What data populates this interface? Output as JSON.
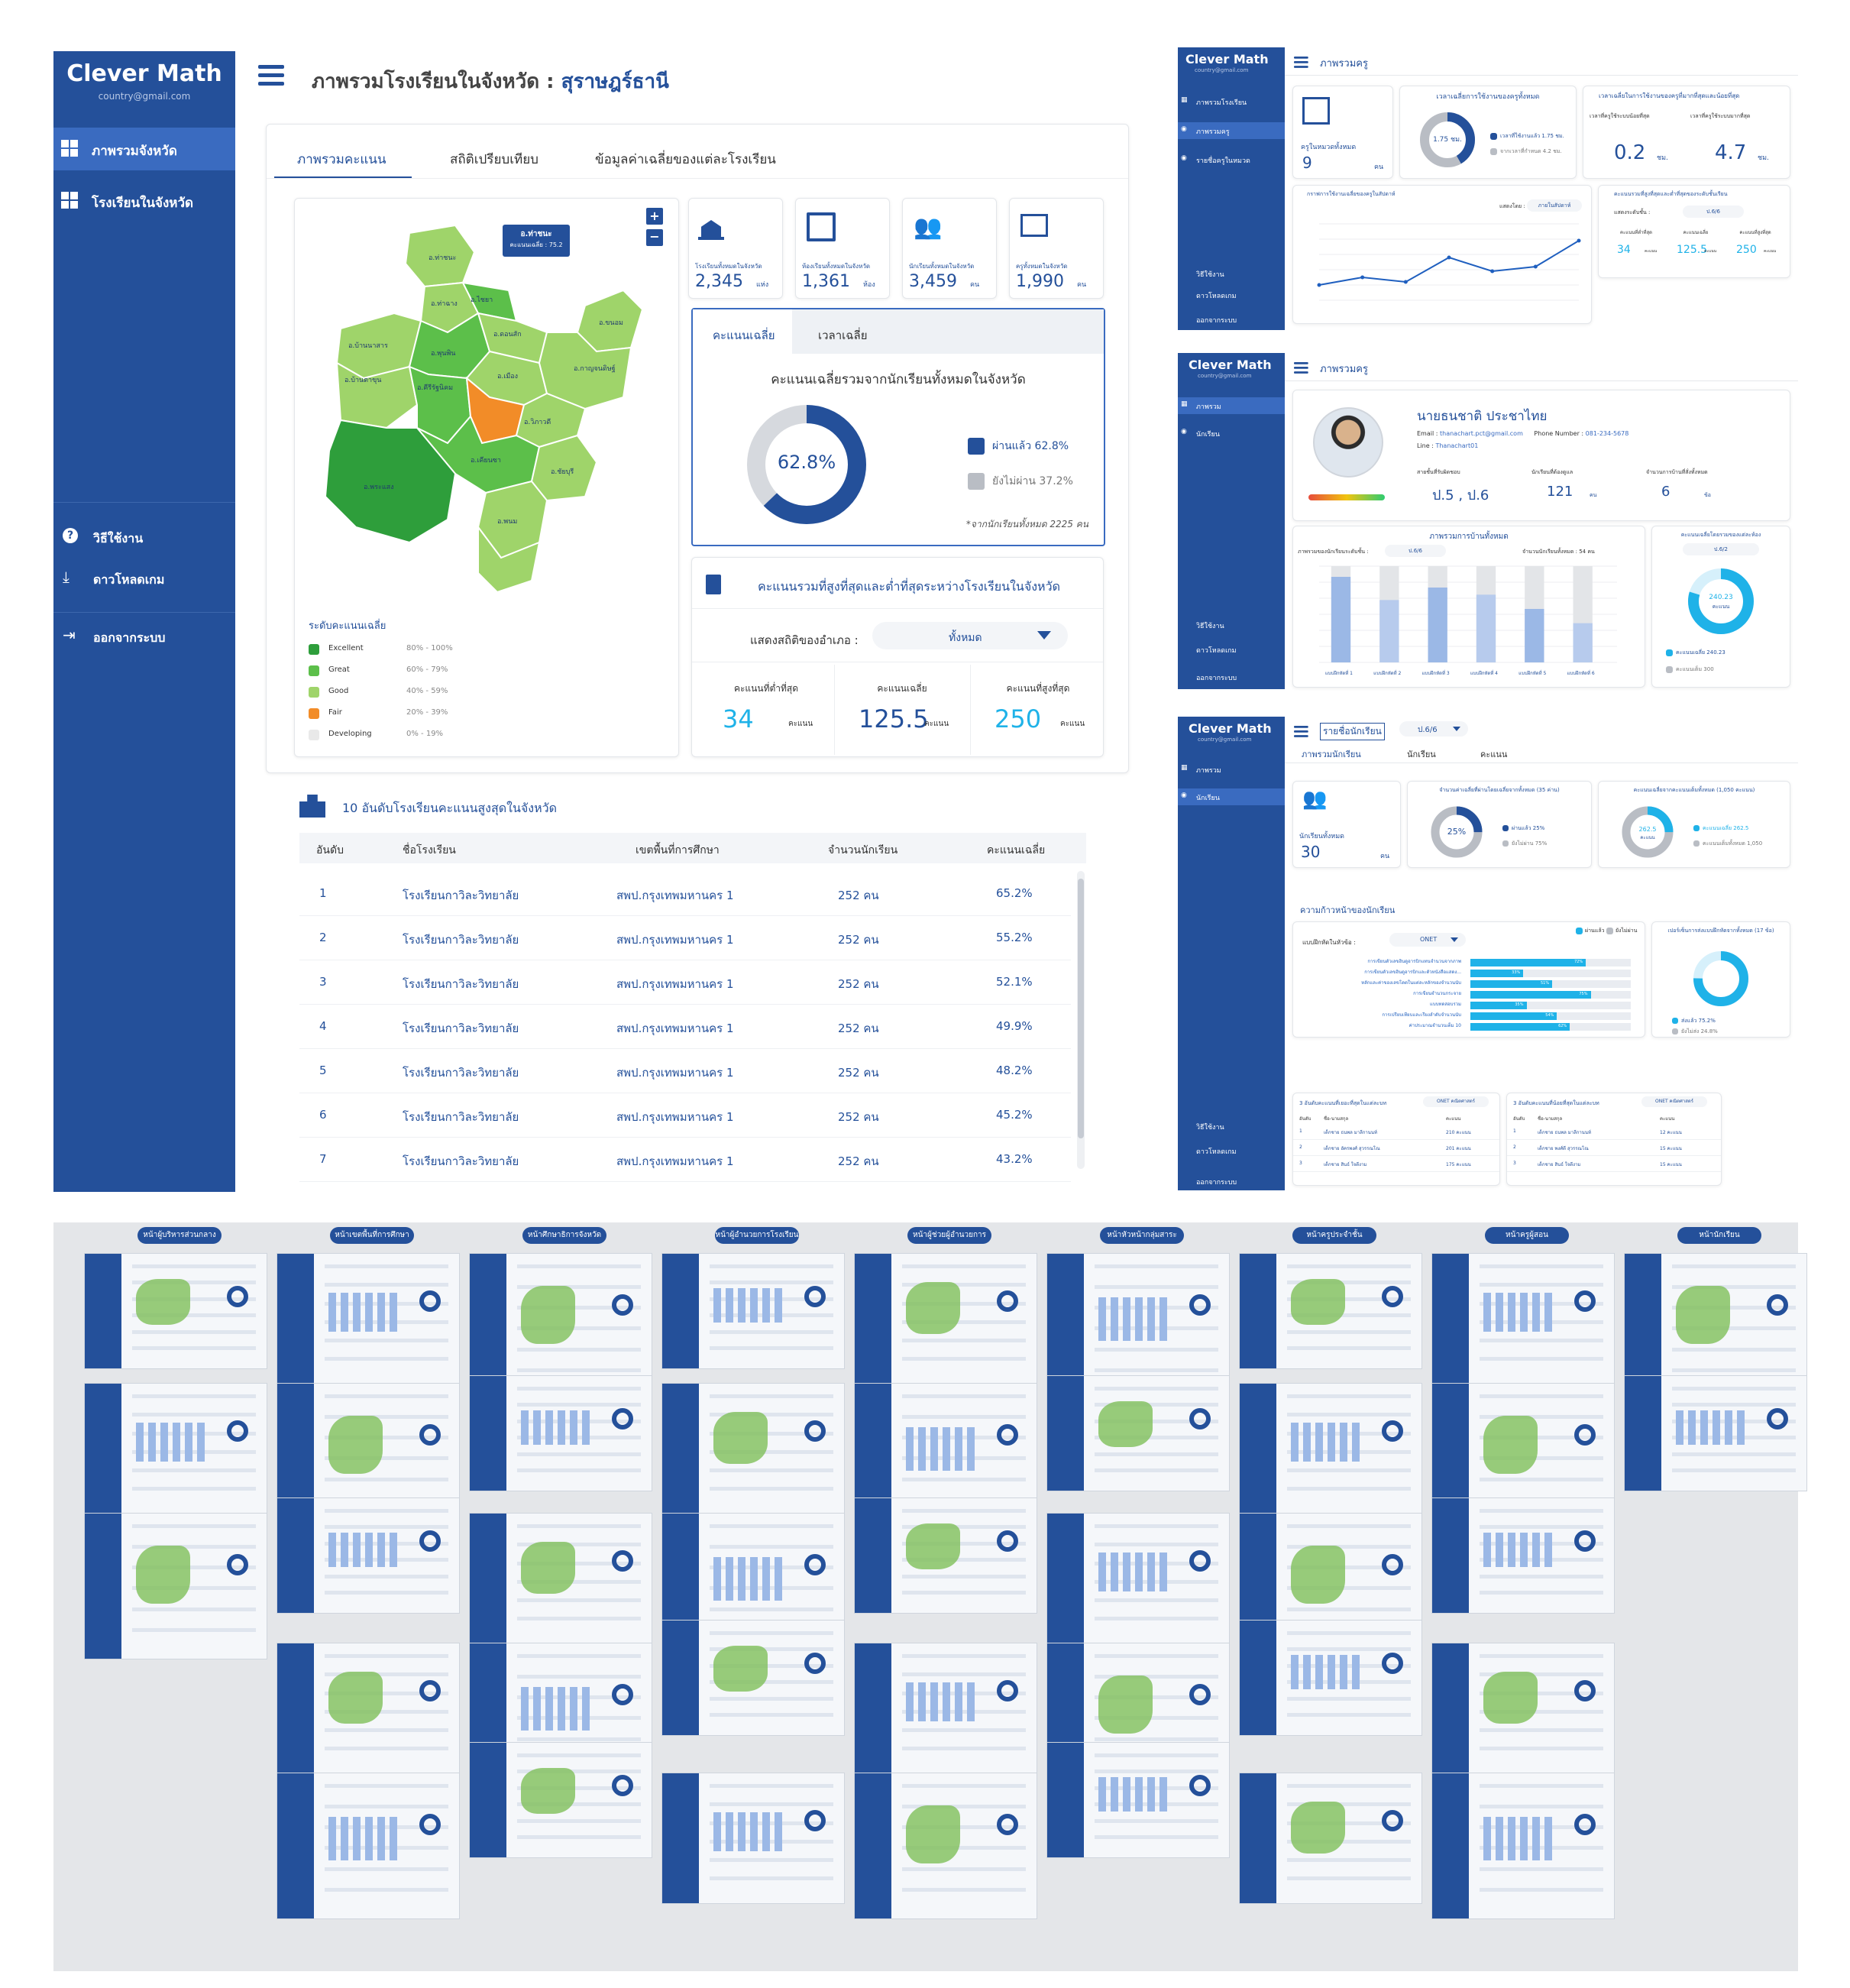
{
  "app": {
    "name": "Clever Math",
    "email": "country@gmail.com"
  },
  "main": {
    "title_prefix": "ภาพรวมโรงเรียนในจังหวัด :",
    "province": "สุราษฎร์ธานี",
    "sidebar": {
      "items": [
        {
          "label": "ภาพรวมจังหวัด",
          "active": true
        },
        {
          "label": "โรงเรียนในจังหวัด",
          "active": false
        }
      ],
      "bottom": [
        {
          "label": "วิธีใช้งาน",
          "icon": "help-icon"
        },
        {
          "label": "ดาวโหลดเกม",
          "icon": "download-icon"
        },
        {
          "label": "ออกจากระบบ",
          "icon": "logout-icon"
        }
      ]
    },
    "tabs": [
      "ภาพรวมคะแนน",
      "สถิติเปรียบเทียบ",
      "ข้อมูลค่าเฉลี่ยของแต่ละโรงเรียน"
    ],
    "map": {
      "tooltip_title": "อ.ท่าชนะ",
      "tooltip_value": "คะแนนเฉลี่ย : 75.2",
      "legend_title": "ระดับคะแนนเฉลี่ย",
      "legend": [
        {
          "label": "Excellent",
          "range": "80% - 100%",
          "color": "#2e9e3b"
        },
        {
          "label": "Great",
          "range": "60% - 79%",
          "color": "#5cbf4a"
        },
        {
          "label": "Good",
          "range": "40% - 59%",
          "color": "#9fd46a"
        },
        {
          "label": "Fair",
          "range": "20% - 39%",
          "color": "#f28c28"
        },
        {
          "label": "Developing",
          "range": "0% - 19%",
          "color": "#e9e9e9"
        }
      ],
      "districts": [
        "อ.ท่าชนะ",
        "อ.ท่าฉาง",
        "อ.ไชยา",
        "อ.พุนพิน",
        "อ.ดอนสัก",
        "อ.ขนอม",
        "อ.กาญจนดิษฐ์",
        "อ.เมือง",
        "อ.เคียนซา",
        "อ.บ้านนาสาร",
        "อ.พระแสง",
        "อ.ชัยบุรี",
        "อ.คีรีรัฐนิคม",
        "อ.วิภาวดี",
        "อ.พนม",
        "อ.บ้านตาขุน"
      ]
    },
    "stats": [
      {
        "label": "โรงเรียนทั้งหมดในจังหวัด",
        "value": "2,345",
        "unit": "แห่ง",
        "icon": "school-icon"
      },
      {
        "label": "ห้องเรียนทั้งหมดในจังหวัด",
        "value": "1,361",
        "unit": "ห้อง",
        "icon": "classroom-icon"
      },
      {
        "label": "นักเรียนทั้งหมดในจังหวัด",
        "value": "3,459",
        "unit": "คน",
        "icon": "students-icon"
      },
      {
        "label": "ครูทั้งหมดในจังหวัด",
        "value": "1,990",
        "unit": "คน",
        "icon": "teacher-icon"
      }
    ],
    "score_card": {
      "tabs": [
        "คะแนนเฉลี่ย",
        "เวลาเฉลี่ย"
      ],
      "title": "คะแนนเฉลี่ยรวมจากนักเรียนทั้งหมดในจังหวัด",
      "center": "62.8%",
      "passed_label": "ผ่านแล้ว 62.8%",
      "failed_label": "ยังไม่ผ่าน 37.2%",
      "note": "*จากนักเรียนทั้งหมด 2225 คน",
      "passed": 62.8,
      "color_pass": "#24509a",
      "color_fail": "#d6d9de"
    },
    "minmax": {
      "title": "คะแนนรวมที่สูงที่สุดและต่ำที่สุดระหว่างโรงเรียนในจังหวัด",
      "filter_label": "แสดงสถิติของอำเภอ :",
      "filter_value": "ทั้งหมด",
      "cols": [
        {
          "label": "คะแนนที่ต่ำที่สุด",
          "value": "34",
          "unit": "คะแนน"
        },
        {
          "label": "คะแนนเฉลี่ย",
          "value": "125.5",
          "unit": "คะแนน"
        },
        {
          "label": "คะแนนที่สูงที่สุด",
          "value": "250",
          "unit": "คะแนน"
        }
      ]
    },
    "top10": {
      "title": "10 อันดับโรงเรียนคะแนนสูงสุดในจังหวัด",
      "headers": [
        "อันดับ",
        "ชื่อโรงเรียน",
        "เขตพื้นที่การศึกษา",
        "จำนวนนักเรียน",
        "คะแนนเฉลี่ย"
      ],
      "rows": [
        [
          "1",
          "โรงเรียนกาวิละวิทยาลัย",
          "สพป.กรุงเทพมหานคร 1",
          "252 คน",
          "65.2%"
        ],
        [
          "2",
          "โรงเรียนกาวิละวิทยาลัย",
          "สพป.กรุงเทพมหานคร 1",
          "252 คน",
          "55.2%"
        ],
        [
          "3",
          "โรงเรียนกาวิละวิทยาลัย",
          "สพป.กรุงเทพมหานคร 1",
          "252 คน",
          "52.1%"
        ],
        [
          "4",
          "โรงเรียนกาวิละวิทยาลัย",
          "สพป.กรุงเทพมหานคร 1",
          "252 คน",
          "49.9%"
        ],
        [
          "5",
          "โรงเรียนกาวิละวิทยาลัย",
          "สพป.กรุงเทพมหานคร 1",
          "252 คน",
          "48.2%"
        ],
        [
          "6",
          "โรงเรียนกาวิละวิทยาลัย",
          "สพป.กรุงเทพมหานคร 1",
          "252 คน",
          "45.2%"
        ],
        [
          "7",
          "โรงเรียนกาวิละวิทยาลัย",
          "สพป.กรุงเทพมหานคร 1",
          "252 คน",
          "43.2%"
        ]
      ]
    }
  },
  "panel1": {
    "app_name": "Clever Math",
    "email": "country@gmail.com",
    "title": "ภาพรวมครู",
    "nav": [
      "ภาพรวมโรงเรียน",
      "ภาพรวมครู",
      "รายชื่อครูในหมวด"
    ],
    "bottom": [
      "วิธีใช้งาน",
      "ดาวโหลดเกม",
      "ออกจากระบบ"
    ],
    "teachers_label": "ครูในหมวดทั้งหมด",
    "teachers_value": "9",
    "teachers_unit": "คน",
    "donut_title": "เวลาเฉลี่ยการใช้งานของครูทั้งหมด",
    "donut_center": "1.75 ชม.",
    "donut_legend": [
      "เวลาที่ใช้งานแล้ว 1.75 ชม.",
      "จากเวลาที่กำหนด 4.2 ชม."
    ],
    "time_title": "เวลาเฉลี่ยในการใช้งานของครูที่มากที่สุดและน้อยที่สุด",
    "min_label": "เวลาที่ครูใช้ระบบน้อยที่สุด",
    "min_value": "0.2",
    "min_unit": "ชม.",
    "max_label": "เวลาที่ครูใช้ระบบมากที่สุด",
    "max_value": "4.7",
    "max_unit": "ชม.",
    "line_title": "กราฟการใช้งานเฉลี่ยของครูในสัปดาห์",
    "line_filter_label": "แสดงโดย :",
    "line_filter_value": "ภายในสัปดาห์",
    "line_values": [
      1,
      1.5,
      1.2,
      2.8,
      1.9,
      2.2,
      3.9
    ],
    "grade_title": "คะแนนรวมที่สูงที่สุดและต่ำที่สุดของระดับชั้นเรียน",
    "grade_filter_label": "แสดงระดับชั้น :",
    "grade_filter_value": "ป.6/6",
    "grade_cols": [
      {
        "label": "คะแนนที่ต่ำที่สุด",
        "value": "34",
        "unit": "คะแนน"
      },
      {
        "label": "คะแนนเฉลี่ย",
        "value": "125.5",
        "unit": "คะแนน"
      },
      {
        "label": "คะแนนที่สูงที่สุด",
        "value": "250",
        "unit": "คะแนน"
      }
    ]
  },
  "panel2": {
    "app_name": "Clever Math",
    "email": "country@gmail.com",
    "title": "ภาพรวมครู",
    "nav": [
      "ภาพรวม",
      "นักเรียน"
    ],
    "bottom": [
      "วิธีใช้งาน",
      "ดาวโหลดเกม",
      "ออกจากระบบ"
    ],
    "teacher_name": "นายธนชาติ ประชาไทย",
    "email_label": "Email :",
    "email_value": "thanachart.pct@gmail.com",
    "phone_label": "Phone Number :",
    "phone_value": "081-234-5678",
    "line_label": "Line :",
    "line_value": "Thanachart01",
    "meta": [
      {
        "label": "สายชั้นที่รับผิดชอบ",
        "value": "ป.5 , ป.6"
      },
      {
        "label": "นักเรียนที่ต้องดูแล",
        "value": "121",
        "unit": "คน"
      },
      {
        "label": "จำนวนการบ้านที่สั่งทั้งหมด",
        "value": "6",
        "unit": "ข้อ"
      }
    ],
    "bar_title": "ภาพรวมการบ้านทั้งหมด",
    "bar_filter_label": "ภาพรวมของนักเรียนระดับชั้น :",
    "bar_filter_value": "ป.6/6",
    "bar_count_label": "จำนวนนักเรียนทั้งหมด : 54 คน",
    "bar_values": [
      48,
      35,
      42,
      38,
      30,
      22
    ],
    "bar_cats": [
      "แบบฝึกหัดที่ 1",
      "แบบฝึกหัดที่ 2",
      "แบบฝึกหัดที่ 3",
      "แบบฝึกหัดที่ 4",
      "แบบฝึกหัดที่ 5",
      "แบบฝึกหัดที่ 6"
    ],
    "avg_title": "คะแนนเฉลี่ยโดยรวมของแต่ละห้อง",
    "avg_filter": "ป.6/2",
    "avg_center": "240.23",
    "avg_unit": "คะแนน",
    "avg_legend": [
      "คะแนนเฉลี่ย 240.23",
      "คะแนนเต็ม 300"
    ]
  },
  "panel3": {
    "app_name": "Clever Math",
    "email": "country@gmail.com",
    "title": "รายชื่อนักเรียน",
    "class_value": "ป.6/6",
    "nav": [
      "ภาพรวม",
      "นักเรียน"
    ],
    "bottom": [
      "วิธีใช้งาน",
      "ดาวโหลดเกม",
      "ออกจากระบบ"
    ],
    "tabs": [
      "ภาพรวมนักเรียน",
      "นักเรียน",
      "คะแนน"
    ],
    "students_label": "นักเรียนทั้งหมด",
    "students_value": "30",
    "students_unit": "คน",
    "pass_title": "จำนวนค่าเฉลี่ยที่ผ่านโดยเฉลี่ยจากทั้งหมด (35 ค่าน)",
    "pass_center": "25%",
    "pass_legend": [
      "ผ่านแล้ว 25%",
      "ยังไม่ผ่าน 75%"
    ],
    "score_title": "คะแนนเฉลี่ยจากคะแนนเต็มทั้งหมด (1,050 คะแนน)",
    "score_center": "262.5",
    "score_unit": "คะแนน",
    "score_legend": [
      "คะแนนเฉลี่ย 262.5",
      "คะแนนเต็มทั้งหมด 1,050"
    ],
    "progress_title": "ความก้าวหน้าของนักเรียน",
    "progress_legend": [
      "ผ่านแล้ว",
      "ยังไม่ผ่าน"
    ],
    "progress_filter_label": "แบบฝึกหัดในหัวข้อ :",
    "progress_filter_value": "ONET",
    "progress": [
      {
        "label": "การเขียนตัวเลขฮินดูอารบิกแทนจำนวนจากภาพ",
        "value": 72
      },
      {
        "label": "การเขียนตัวเลขฮินดูอารบิกและตัวหนังสือแสดง...",
        "value": 33
      },
      {
        "label": "หลักและค่าของเลขโดดในแต่ละหลักของจำนวนนับ",
        "value": 51
      },
      {
        "label": "การเขียนจำนวนกระจาย",
        "value": 75
      },
      {
        "label": "แบบทดสอบรวม",
        "value": 35
      },
      {
        "label": "การเปรียบเทียบและเรียงลำดับจำนวนนับ",
        "value": 54
      },
      {
        "label": "ค่าประมาณจำนวนเต็ม 10",
        "value": 62
      }
    ],
    "side_title": "เปอร์เซ็นการส่งแบบฝึกหัดจากทั้งหมด (17 ข้อ)",
    "side_legend": [
      "ส่งแล้ว 75.2%",
      "ยังไม่ส่ง 24.8%"
    ],
    "side_value": 75.2,
    "t1_title": "3 อันดับคะแนนที่เยอะที่สุดในแต่ละบท",
    "t2_title": "3 อันดับคะแนนที่น้อยที่สุดในแต่ละบท",
    "t_filter": "ONET คณิตศาสตร์",
    "t_headers": [
      "อันดับ",
      "ชื่อ-นามสกุล",
      "คะแนน"
    ],
    "t1_rows": [
      [
        "1",
        "เด็กชาย ธนพล มาลีกานนท์",
        "210 คะแนน"
      ],
      [
        "2",
        "เด็กชาย อัครพงศ์ สุวรรณโณ",
        "201 คะแนน"
      ],
      [
        "3",
        "เด็กชาย สินธ์ ใจดีงาม",
        "175 คะแนน"
      ]
    ],
    "t2_rows": [
      [
        "1",
        "เด็กชาย ธนพล มาลีกานนท์",
        "12 คะแนน"
      ],
      [
        "2",
        "เด็กชาย พงศ์ดี สุวรรณโณ",
        "15 คะแนน"
      ],
      [
        "3",
        "เด็กชาย สินธ์ ใจดีงาม",
        "15 คะแนน"
      ]
    ]
  },
  "overview": {
    "column_labels": [
      "หน้าผู้บริหารส่วนกลาง",
      "หน้าเขตพื้นที่การศึกษา",
      "หน้าศึกษาธิการจังหวัด",
      "หน้าผู้อำนวยการโรงเรียน",
      "หน้าผู้ช่วยผู้อำนวยการ",
      "หน้าหัวหน้ากลุ่มสาระ",
      "หน้าครูประจำชั้น",
      "หน้าครูผู้สอน",
      "หน้านักเรียน"
    ]
  },
  "colors": {
    "primary": "#24509a",
    "accent": "#1fb2e8",
    "orange": "#f28c28"
  }
}
